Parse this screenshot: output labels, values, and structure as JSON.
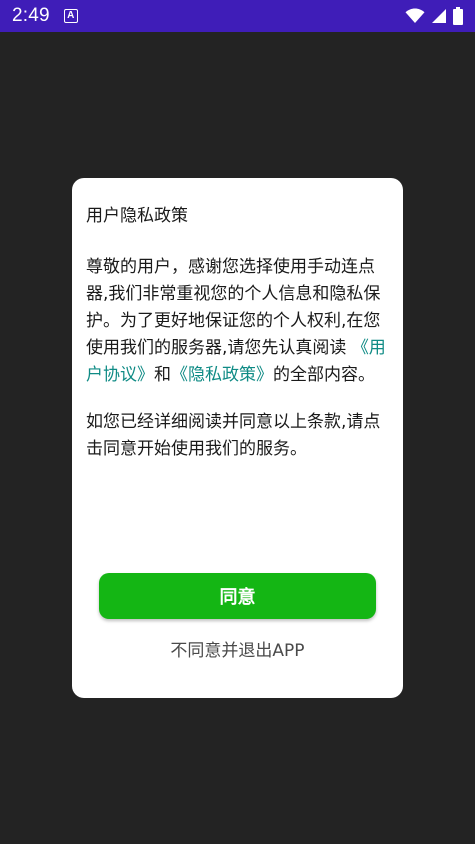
{
  "status_bar": {
    "time": "2:49",
    "app_icon_letter": "A",
    "icons": [
      "wifi-icon",
      "signal-icon",
      "battery-icon"
    ]
  },
  "dialog": {
    "title": "用户隐私政策",
    "paragraph1": {
      "text_before": "尊敬的用户，感谢您选择使用手动连点器,我们非常重视您的个人信息和隐私保护。为了更好地保证您的个人权利,在您使用我们的服务器,请您先认真阅读",
      "user_agreement_link": "《用户协议》",
      "conjunction": "和",
      "privacy_policy_link": "《隐私政策》",
      "text_after": "的全部内容。"
    },
    "paragraph2": "如您已经详细阅读并同意以上条款,请点击同意开始使用我们的服务。",
    "agree_button": "同意",
    "disagree_link": "不同意并退出APP"
  },
  "colors": {
    "status_bar": "#3f1db8",
    "background": "#232323",
    "link": "#0f8b85",
    "agree_button": "#14b614"
  }
}
